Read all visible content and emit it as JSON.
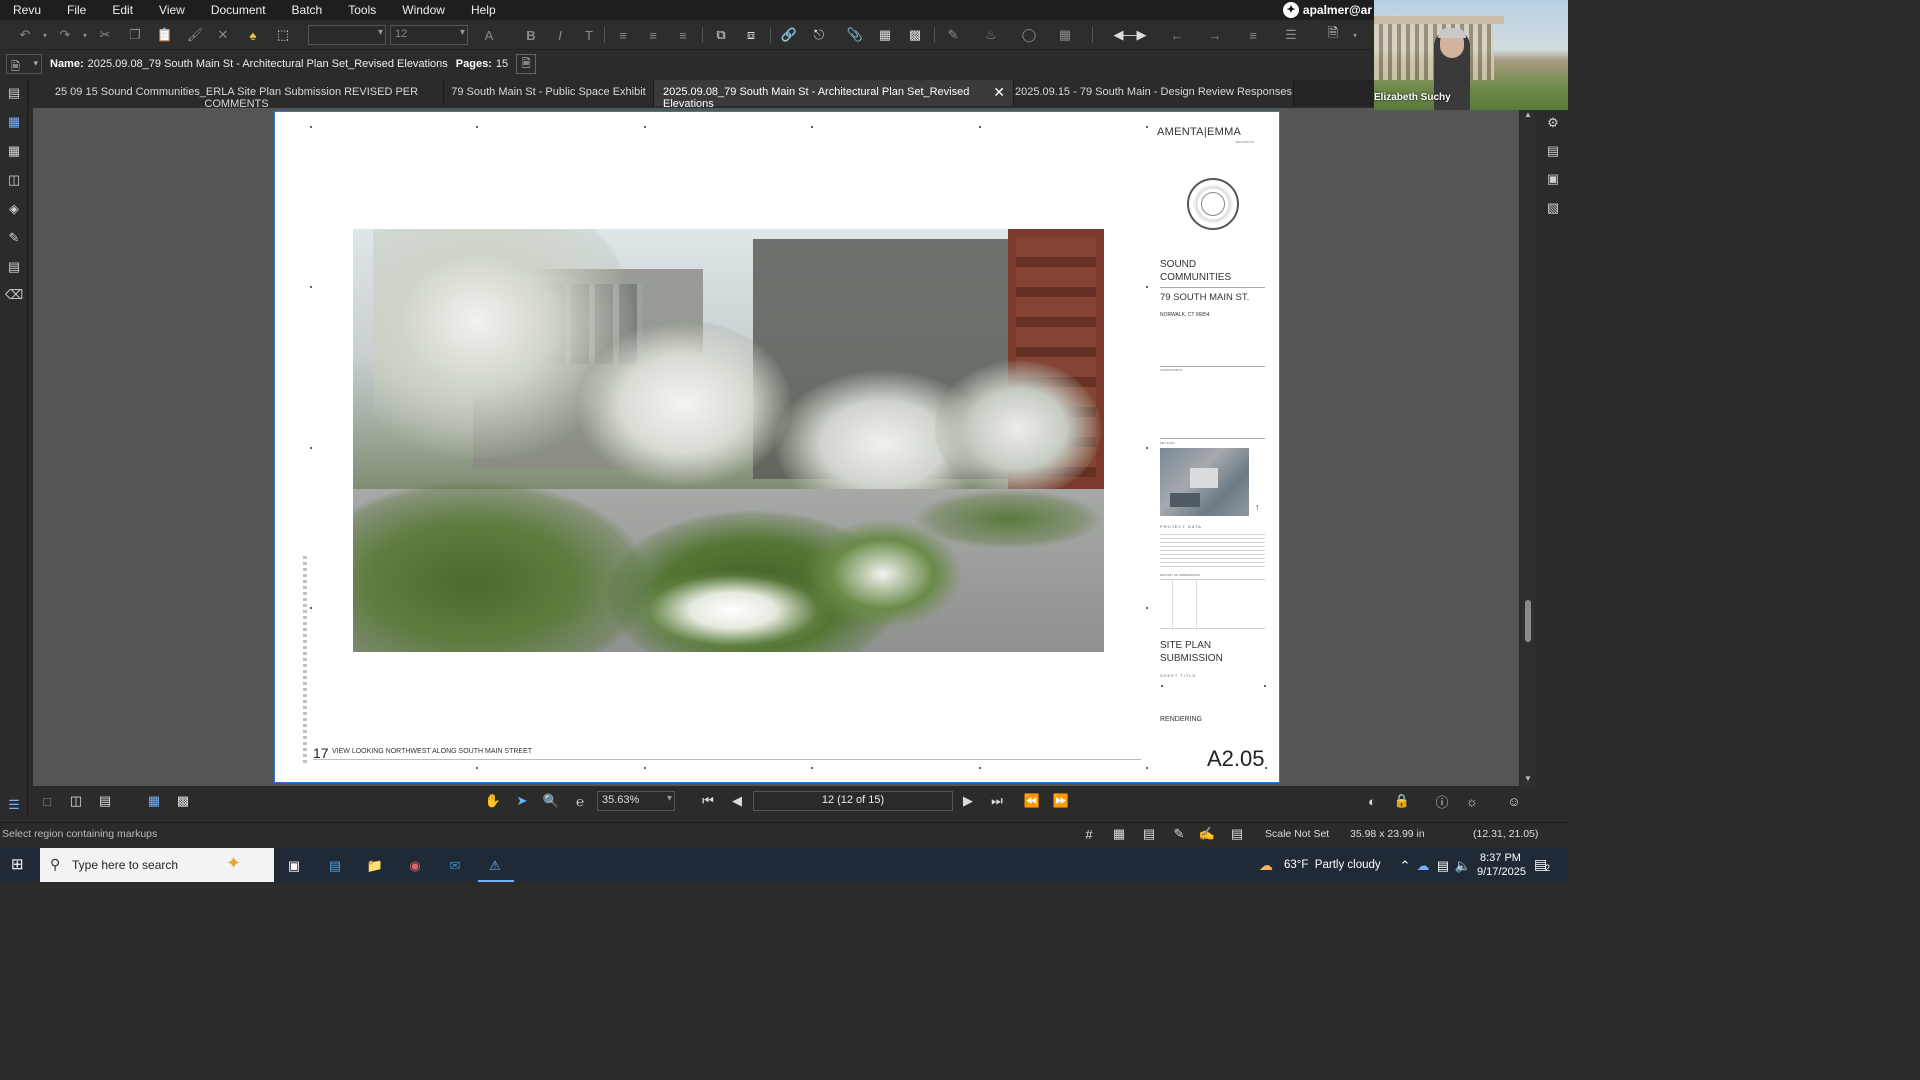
{
  "menu": [
    "Revu",
    "File",
    "Edit",
    "View",
    "Document",
    "Batch",
    "Tools",
    "Window",
    "Help"
  ],
  "account": {
    "user": "apalmer@ar"
  },
  "toolbar": {
    "font_box": "",
    "size_box": "12"
  },
  "properties": {
    "name_label": "Name:",
    "name_value": "2025.09.08_79 South Main St - Architectural Plan Set_Revised Elevations",
    "pages_label": "Pages:",
    "pages_value": "15"
  },
  "tabs": [
    {
      "label": "25 09 15 Sound Communities_ERLA Site Plan Submission REVISED PER COMMENTS"
    },
    {
      "label": "79 South Main St - Public Space Exhibit"
    },
    {
      "label": "2025.09.08_79 South Main St - Architectural Plan Set_Revised Elevations"
    },
    {
      "label": "2025.09.15 - 79 South Main - Design Review Responses"
    }
  ],
  "video": {
    "participant": "Elizabeth Suchy"
  },
  "sheet": {
    "firm": "AMENTA|EMMA",
    "firm_sub": "ARCHITECTS",
    "client_1": "SOUND",
    "client_2": "COMMUNITIES",
    "address": "79 SOUTH MAIN ST.",
    "city": "NORWALK, CT 06854",
    "consultants": "CONSULTANTS",
    "key_plan": "KEY PLAN",
    "project_data": "PROJECT DATA",
    "history": "HISTORY OF SUBMISSIONS",
    "submission_1": "SITE PLAN",
    "submission_2": "SUBMISSION",
    "sheet_title_label": "SHEET TITLE",
    "sheet_title": "RENDERING",
    "sheet_number": "A2.05",
    "view_number": "17",
    "view_caption": "VIEW LOOKING NORTHWEST ALONG SOUTH MAIN STREET"
  },
  "nav": {
    "zoom": "35.63%",
    "page": "12 (12 of 15)"
  },
  "status": {
    "hint": "Select region containing markups",
    "scale": "Scale Not Set",
    "size": "35.98 x 23.99 in",
    "coords": "(12.31, 21.05)"
  },
  "taskbar": {
    "search_placeholder": "Type here to search",
    "weather": "63°F  Partly cloudy",
    "time": "8:37 PM",
    "date": "9/17/2025",
    "notifications": "2"
  },
  "colors": {
    "accent": "#2a78d8",
    "chrome": "#2b2b2b",
    "taskbar": "#1f2a36"
  }
}
